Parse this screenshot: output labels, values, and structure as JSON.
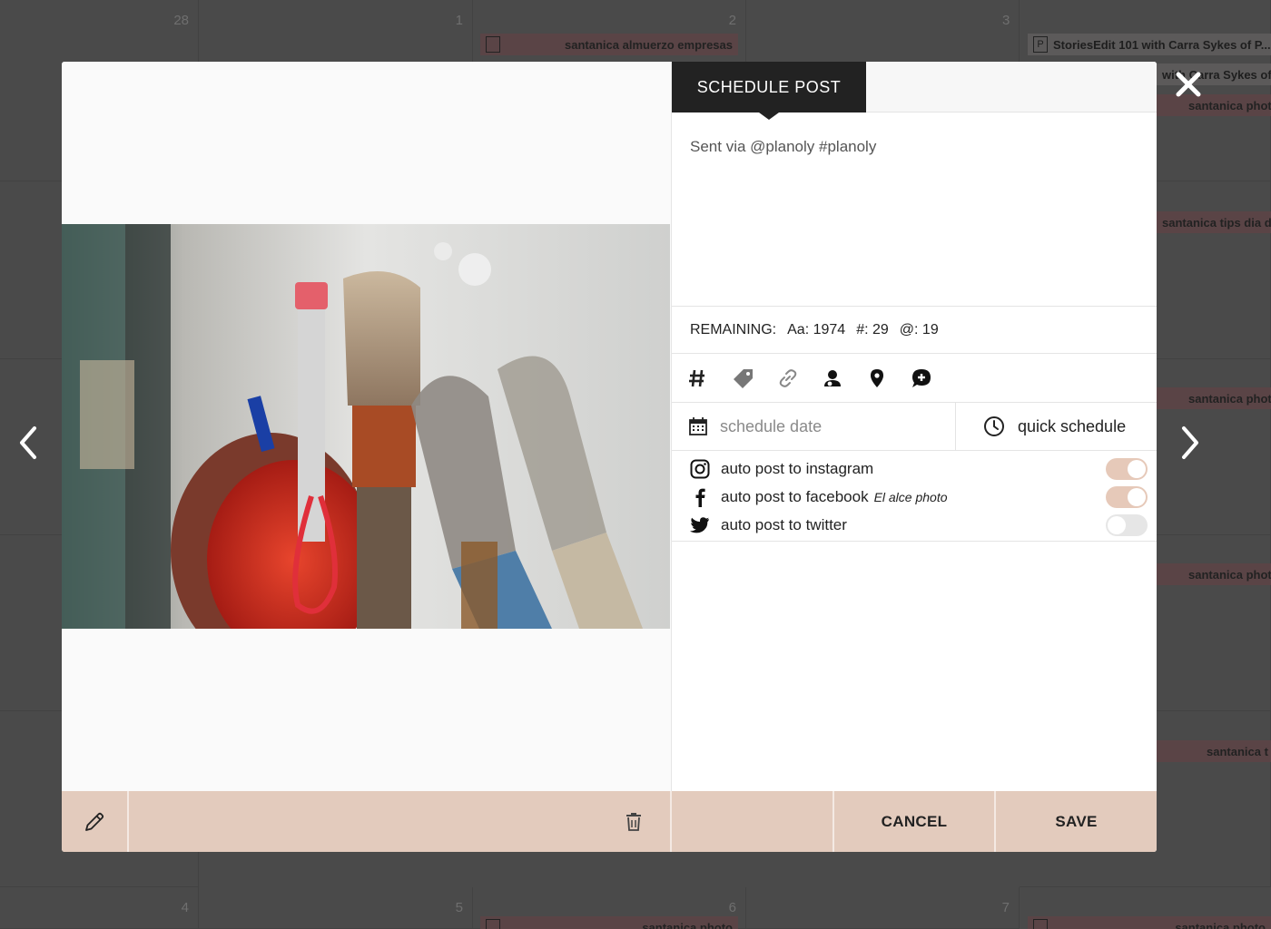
{
  "calendar": {
    "day_numbers": [
      "28",
      "1",
      "2",
      "3",
      "4",
      "5",
      "6",
      "7"
    ],
    "events": {
      "e1": "santanica almuerzo empresas",
      "e2": "StoriesEdit 101 with Carra Sykes of P...",
      "e3": "with Carra Sykes of P...",
      "e4": "santanica photo",
      "e5": "santanica tips dia del padre",
      "e6": "santanica photo",
      "e7": "santanica photo",
      "e8": "santanica t",
      "e9": "santanica photo",
      "e10": "santanica photo"
    },
    "event_color": "#5a4446"
  },
  "modal": {
    "tab": "SCHEDULE POST",
    "caption": "Sent via @planoly #planoly",
    "remaining": {
      "label": "REMAINING:",
      "chars": "Aa: 1974",
      "hashtags": "#: 29",
      "mentions": "@: 19"
    },
    "tools": [
      "hashtag-icon",
      "tag-icon",
      "link-icon",
      "user-tag-icon",
      "location-icon",
      "add-comment-icon"
    ],
    "schedule": {
      "date_placeholder": "schedule date",
      "quick": "quick schedule"
    },
    "autopost": {
      "instagram": {
        "label": "auto post to instagram",
        "on": true
      },
      "facebook": {
        "label": "auto post to facebook",
        "page": "El alce photo",
        "on": true
      },
      "twitter": {
        "label": "auto post to twitter",
        "on": false
      }
    },
    "footer": {
      "cancel": "CANCEL",
      "save": "SAVE",
      "color": "#e3cbbd"
    }
  }
}
